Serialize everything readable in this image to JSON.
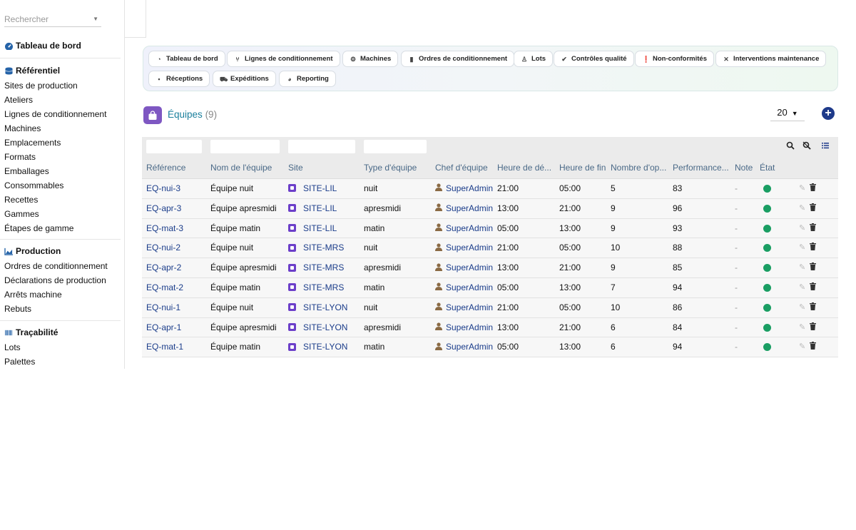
{
  "sidebar": {
    "search_placeholder": "Rechercher",
    "dashboard": "Tableau de bord",
    "sections": [
      {
        "title": "Référentiel",
        "items": [
          "Sites de production",
          "Ateliers",
          "Lignes de conditionnement",
          "Machines",
          "Emplacements",
          "Formats",
          "Emballages",
          "Consommables",
          "Recettes",
          "Gammes",
          "Étapes de gamme"
        ]
      },
      {
        "title": "Production",
        "items": [
          "Ordres de conditionnement",
          "Déclarations de production",
          "Arrêts machine",
          "Rebuts"
        ]
      },
      {
        "title": "Traçabilité",
        "items": [
          "Lots",
          "Palettes"
        ]
      }
    ]
  },
  "nav": {
    "row1": [
      "Tableau de bord",
      "Lignes de conditionnement",
      "Machines",
      "Ordres de conditionnement",
      "Lots",
      "Contrôles qualité",
      "Non-conformités",
      "Interventions maintenance"
    ],
    "row2": [
      "Réceptions",
      "Expéditions",
      "Reporting"
    ]
  },
  "page": {
    "title": "Équipes",
    "count": "(9)",
    "page_size": "20"
  },
  "table": {
    "columns": [
      "Référence",
      "Nom de l'équipe",
      "Site",
      "Type d'équipe",
      "Chef d'équipe",
      "Heure de dé...",
      "Heure de fin",
      "Nombre d'op...",
      "Performance...",
      "Note",
      "État"
    ],
    "rows": [
      {
        "ref": "EQ-nui-3",
        "nom": "Équipe nuit",
        "site": "SITE-LIL",
        "type": "nuit",
        "chef": "SuperAdmin",
        "debut": "21:00",
        "fin": "05:00",
        "nb": "5",
        "perf": "83",
        "note": "-"
      },
      {
        "ref": "EQ-apr-3",
        "nom": "Équipe apresmidi",
        "site": "SITE-LIL",
        "type": "apresmidi",
        "chef": "SuperAdmin",
        "debut": "13:00",
        "fin": "21:00",
        "nb": "9",
        "perf": "96",
        "note": "-"
      },
      {
        "ref": "EQ-mat-3",
        "nom": "Équipe matin",
        "site": "SITE-LIL",
        "type": "matin",
        "chef": "SuperAdmin",
        "debut": "05:00",
        "fin": "13:00",
        "nb": "9",
        "perf": "93",
        "note": "-"
      },
      {
        "ref": "EQ-nui-2",
        "nom": "Équipe nuit",
        "site": "SITE-MRS",
        "type": "nuit",
        "chef": "SuperAdmin",
        "debut": "21:00",
        "fin": "05:00",
        "nb": "10",
        "perf": "88",
        "note": "-"
      },
      {
        "ref": "EQ-apr-2",
        "nom": "Équipe apresmidi",
        "site": "SITE-MRS",
        "type": "apresmidi",
        "chef": "SuperAdmin",
        "debut": "13:00",
        "fin": "21:00",
        "nb": "9",
        "perf": "85",
        "note": "-"
      },
      {
        "ref": "EQ-mat-2",
        "nom": "Équipe matin",
        "site": "SITE-MRS",
        "type": "matin",
        "chef": "SuperAdmin",
        "debut": "05:00",
        "fin": "13:00",
        "nb": "7",
        "perf": "94",
        "note": "-"
      },
      {
        "ref": "EQ-nui-1",
        "nom": "Équipe nuit",
        "site": "SITE-LYON",
        "type": "nuit",
        "chef": "SuperAdmin",
        "debut": "21:00",
        "fin": "05:00",
        "nb": "10",
        "perf": "86",
        "note": "-"
      },
      {
        "ref": "EQ-apr-1",
        "nom": "Équipe apresmidi",
        "site": "SITE-LYON",
        "type": "apresmidi",
        "chef": "SuperAdmin",
        "debut": "13:00",
        "fin": "21:00",
        "nb": "6",
        "perf": "84",
        "note": "-"
      },
      {
        "ref": "EQ-mat-1",
        "nom": "Équipe matin",
        "site": "SITE-LYON",
        "type": "matin",
        "chef": "SuperAdmin",
        "debut": "05:00",
        "fin": "13:00",
        "nb": "6",
        "perf": "94",
        "note": "-"
      }
    ]
  },
  "colors": {
    "accent": "#1a7f9c",
    "status_active": "#1a9e63",
    "site_icon": "#6c3fc9",
    "add_button": "#1e3a8a"
  }
}
